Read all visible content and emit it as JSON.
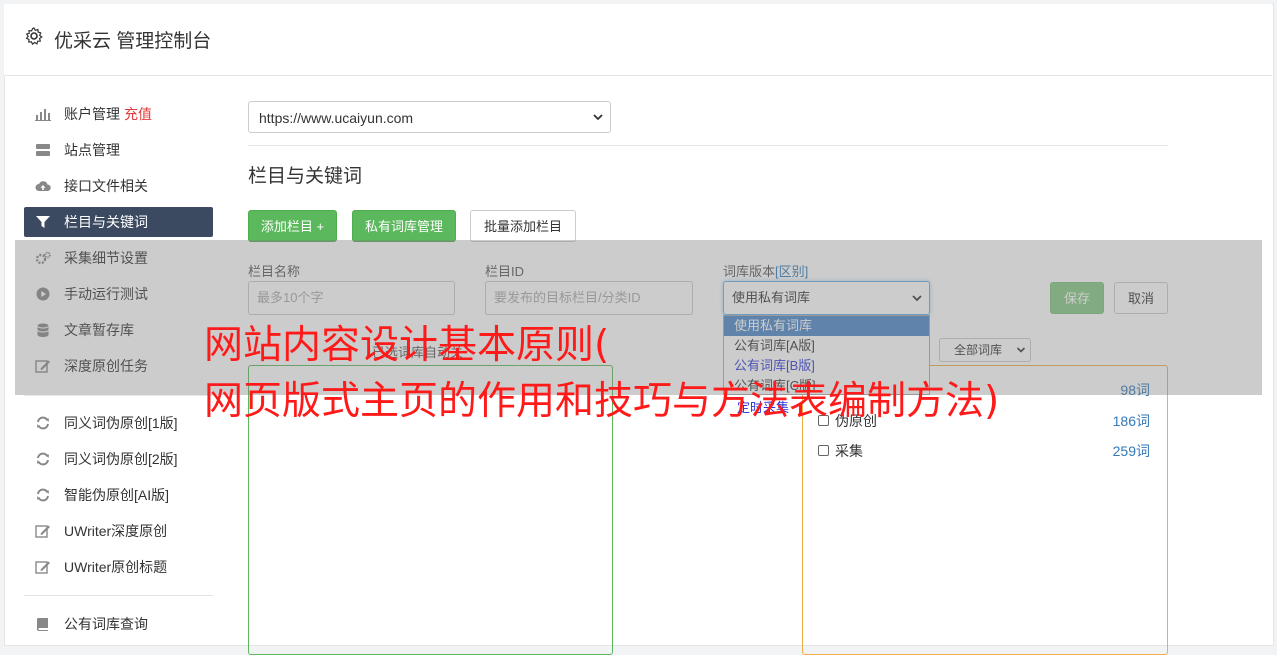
{
  "header": {
    "title": "优采云 管理控制台"
  },
  "sidebar": {
    "items": [
      {
        "label": "账户管理",
        "extra": "充值",
        "icon": "bar-chart-icon"
      },
      {
        "label": "站点管理",
        "icon": "server-icon"
      },
      {
        "label": "接口文件相关",
        "icon": "cloud-upload-icon"
      },
      {
        "label": "栏目与关键词",
        "icon": "filter-icon",
        "active": true
      },
      {
        "label": "采集细节设置",
        "icon": "cogs-icon"
      },
      {
        "label": "手动运行测试",
        "icon": "play-circle-icon"
      },
      {
        "label": "文章暂存库",
        "icon": "database-icon"
      },
      {
        "label": "深度原创任务",
        "icon": "edit-icon"
      },
      {
        "label": "同义词伪原创[1版]",
        "icon": "refresh-icon"
      },
      {
        "label": "同义词伪原创[2版]",
        "icon": "refresh-icon"
      },
      {
        "label": "智能伪原创[AI版]",
        "icon": "refresh-icon"
      },
      {
        "label": "UWriter深度原创",
        "icon": "edit-icon"
      },
      {
        "label": "UWriter原创标题",
        "icon": "edit-icon"
      },
      {
        "label": "公有词库查询",
        "icon": "book-icon"
      }
    ]
  },
  "main": {
    "site_select": "https://www.ucaiyun.com",
    "section_title": "栏目与关键词",
    "buttons": {
      "add_column": "添加栏目 +",
      "private_lib": "私有词库管理",
      "batch_add": "批量添加栏目"
    },
    "form": {
      "name_label": "栏目名称",
      "name_placeholder": "最多10个字",
      "id_label": "栏目ID",
      "id_placeholder": "要发布的目标栏目/分类ID",
      "lib_label": "词库版本",
      "lib_label_tag": "[区别]",
      "lib_value": "使用私有词库",
      "save": "保存",
      "cancel": "取消"
    },
    "dropdown_options": [
      "使用私有词库",
      "公有词库[A版]",
      "公有词库[B版]",
      "公有词库[C版]"
    ],
    "auto_label": "已选词库自动关",
    "filter_select": "全部词库",
    "keywords": [
      {
        "name": "",
        "count": "98词"
      },
      {
        "name": "伪原创",
        "count": "186词"
      },
      {
        "name": "采集",
        "count": "259词"
      }
    ],
    "partial_item": "定时采集"
  },
  "overlay": {
    "line1": "网站内容设计基本原则(",
    "line2": "网页版式主页的作用和技巧与方法表编制方法)"
  },
  "colors": {
    "green": "#5cb85c",
    "dark_nav": "#3c4a61",
    "recharge_red": "#e4393c",
    "overlay_red": "#ff1a1a",
    "link_blue": "#337ab7"
  }
}
